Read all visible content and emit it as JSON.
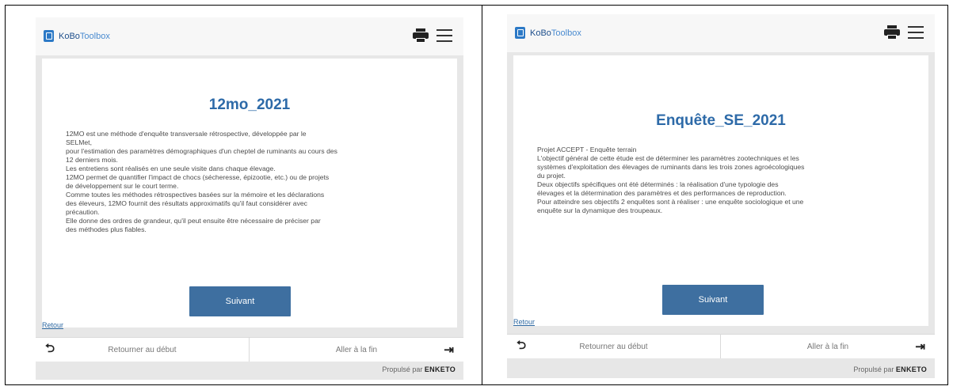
{
  "left": {
    "logo": {
      "part1": "KoBo",
      "part2": "Toolbox"
    },
    "title": "12mo_2021",
    "description": [
      "12MO est une méthode d'enquête transversale rétrospective, développée par le",
      "SELMet,",
      "pour l'estimation des paramètres démographiques d'un cheptel de ruminants au cours des",
      "12 derniers mois.",
      "Les entretiens sont réalisés en une seule visite dans chaque élevage.",
      "12MO permet de quantifier l'impact de chocs (sécheresse, épizootie, etc.) ou de projets",
      "de développement sur le court terme.",
      "Comme toutes les méthodes rétrospectives basées sur la mémoire et les déclarations",
      "des éleveurs, 12MO fournit des résultats approximatifs qu'il faut considérer avec",
      "précaution.",
      "Elle donne des ordres de grandeur, qu'il peut ensuite être nécessaire de préciser par",
      "des méthodes plus fiables."
    ],
    "next_label": "Suivant",
    "back_label": "Retour",
    "nav_start": "Retourner au début",
    "nav_end": "Aller à la fin",
    "powered_prefix": "Propulsé par",
    "powered_brand": "ENKETO"
  },
  "right": {
    "logo": {
      "part1": "KoBo",
      "part2": "Toolbox"
    },
    "title": "Enquête_SE_2021",
    "description": [
      "Projet ACCEPT - Enquête terrain",
      "L'objectif général de cette étude est de déterminer les paramètres zootechniques et les",
      "systèmes d'exploitation des élevages de ruminants dans les trois zones agroécologiques",
      "du projet.",
      "Deux objectifs spécifiques ont été déterminés : la réalisation d'une typologie des",
      "élevages et la détermination des paramètres et des performances de reproduction.",
      "Pour atteindre ses objectifs 2 enquêtes sont à réaliser : une enquête sociologique et une",
      "enquête sur la dynamique des troupeaux."
    ],
    "next_label": "Suivant",
    "back_label": "Retour",
    "nav_start": "Retourner au début",
    "nav_end": "Aller à la fin",
    "powered_prefix": "Propulsé par",
    "powered_brand": "ENKETO"
  },
  "icons": {
    "print": "print-icon",
    "menu": "hamburger-menu-icon",
    "start": "return-arrow-icon",
    "end": "arrow-to-end-icon"
  },
  "colors": {
    "accent": "#3e6fa0",
    "title": "#2d6aa8",
    "panel_bg": "#e7e7e7"
  }
}
